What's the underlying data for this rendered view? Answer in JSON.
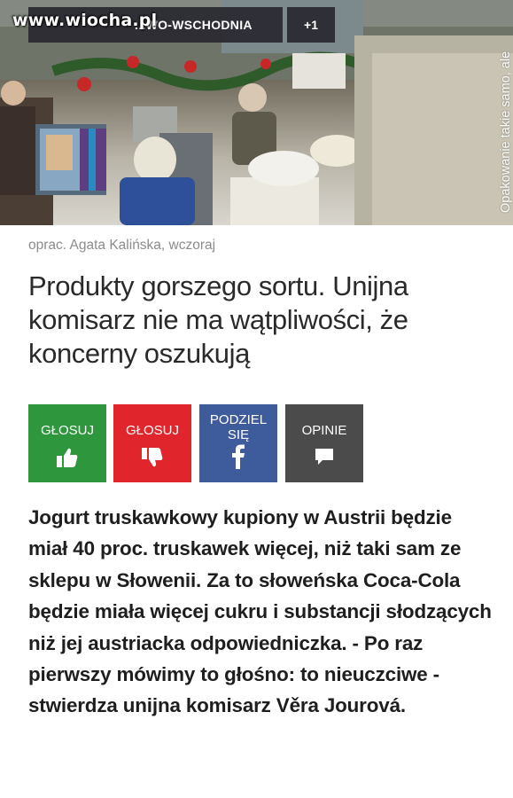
{
  "hero": {
    "watermark": "www.wiocha.pl",
    "tag": "...WO-WSCHODNIA",
    "count": "+1",
    "caption": "Opakowanie takie samo, ale zawartość inna. Na półkach w Europie Wschodniej trafiają gorsze produkty niż w Zachodniej? (East News)"
  },
  "article": {
    "byline": "oprac. Agata Kalińska, wczoraj",
    "headline": "Produkty gorszego sortu. Unijna komisarz nie ma wątpliwości, że koncerny oszukują",
    "lead": "Jogurt truskawkowy kupiony w Austrii będzie miał 40 proc. truskawek więcej, niż taki sam ze sklepu w Słowenii. Za to słoweńska Coca-Cola będzie miała więcej cukru i substancji słodzących niż jej austriacka odpowiedniczka. - Po raz pierwszy mówimy to głośno: to nieuczciwe - stwierdza unijna komisarz Věra Jourová."
  },
  "actions": {
    "vote_up": {
      "label": "GŁOSUJ",
      "icon": "thumbs-up-icon",
      "color": "#2e963d"
    },
    "vote_down": {
      "label": "GŁOSUJ",
      "icon": "thumbs-down-icon",
      "color": "#e0252d"
    },
    "share": {
      "label": "PODZIEL SIĘ",
      "icon": "facebook-icon",
      "color": "#3e5b9c"
    },
    "comments": {
      "label": "OPINIE",
      "icon": "comment-icon",
      "color": "#4b4b4b"
    }
  }
}
